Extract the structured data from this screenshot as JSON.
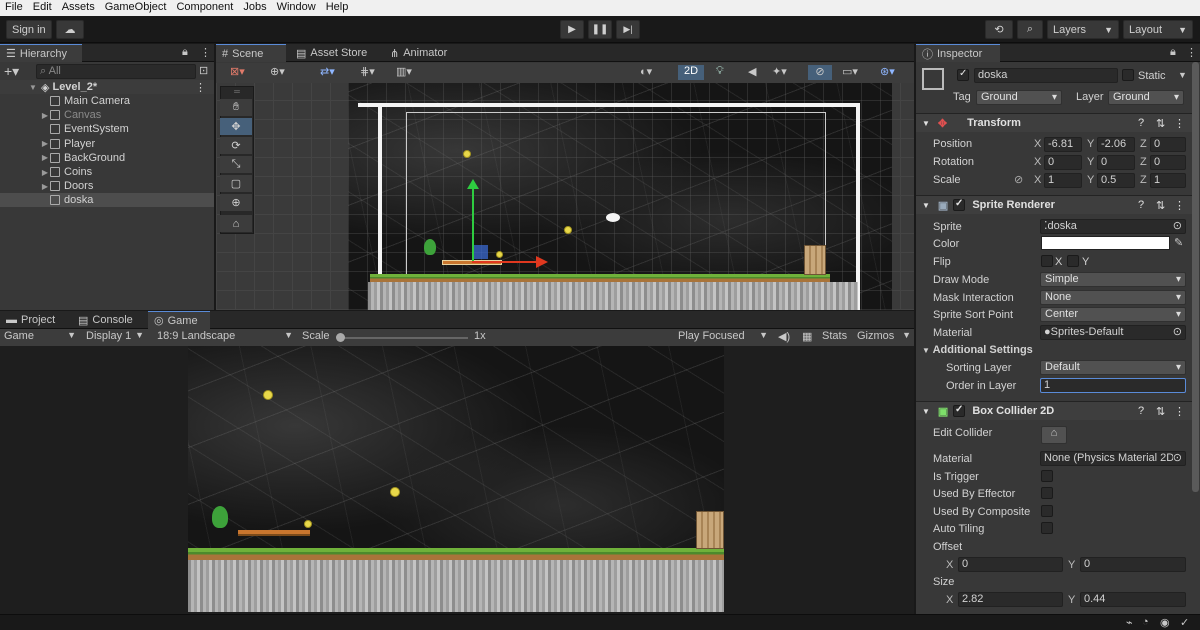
{
  "menu": [
    "File",
    "Edit",
    "Assets",
    "GameObject",
    "Component",
    "Jobs",
    "Window",
    "Help"
  ],
  "toolbar": {
    "sign_in": "Sign in",
    "layers": "Layers",
    "layout": "Layout"
  },
  "hierarchy": {
    "tab": "Hierarchy",
    "search_placeholder": "All",
    "scene": "Level_2*",
    "items": [
      {
        "label": "Main Camera",
        "expandable": false,
        "dim": false
      },
      {
        "label": "Canvas",
        "expandable": true,
        "dim": true
      },
      {
        "label": "EventSystem",
        "expandable": false,
        "dim": false
      },
      {
        "label": "Player",
        "expandable": true,
        "dim": false
      },
      {
        "label": "BackGround",
        "expandable": true,
        "dim": false
      },
      {
        "label": "Coins",
        "expandable": true,
        "dim": false
      },
      {
        "label": "Doors",
        "expandable": true,
        "dim": false
      },
      {
        "label": "doska",
        "expandable": false,
        "dim": false,
        "selected": true
      }
    ]
  },
  "scene_tabs": [
    "Scene",
    "Asset Store",
    "Animator"
  ],
  "scene_toolbar": {
    "mode_2d": "2D"
  },
  "bottom_tabs": [
    "Project",
    "Console",
    "Game"
  ],
  "game_toolbar": {
    "view": "Game",
    "display": "Display 1",
    "aspect": "18:9 Landscape",
    "scale_label": "Scale",
    "scale_value": "1x",
    "play_mode": "Play Focused",
    "stats": "Stats",
    "gizmos": "Gizmos"
  },
  "inspector": {
    "tab": "Inspector",
    "object_name": "doska",
    "static_label": "Static",
    "tag_label": "Tag",
    "tag_value": "Ground",
    "layer_label": "Layer",
    "layer_value": "Ground",
    "transform": {
      "title": "Transform",
      "position_label": "Position",
      "rotation_label": "Rotation",
      "scale_label": "Scale",
      "position": {
        "x": "-6.81",
        "y": "-2.06",
        "z": "0"
      },
      "rotation": {
        "x": "0",
        "y": "0",
        "z": "0"
      },
      "scale": {
        "x": "1",
        "y": "0.5",
        "z": "1"
      }
    },
    "sprite_renderer": {
      "title": "Sprite Renderer",
      "sprite_label": "Sprite",
      "sprite_value": "doska",
      "color_label": "Color",
      "flip_label": "Flip",
      "flip_x": "X",
      "flip_y": "Y",
      "draw_mode_label": "Draw Mode",
      "draw_mode_value": "Simple",
      "mask_label": "Mask Interaction",
      "mask_value": "None",
      "sort_point_label": "Sprite Sort Point",
      "sort_point_value": "Center",
      "material_label": "Material",
      "material_value": "Sprites-Default",
      "additional": "Additional Settings",
      "sorting_layer_label": "Sorting Layer",
      "sorting_layer_value": "Default",
      "order_label": "Order in Layer",
      "order_value": "1"
    },
    "box_collider": {
      "title": "Box Collider 2D",
      "edit_collider_label": "Edit Collider",
      "material_label": "Material",
      "material_value": "None (Physics Material 2D)",
      "is_trigger_label": "Is Trigger",
      "effector_label": "Used By Effector",
      "composite_label": "Used By Composite",
      "auto_tiling_label": "Auto Tiling",
      "offset_label": "Offset",
      "offset": {
        "x": "0",
        "y": "0"
      },
      "size_label": "Size",
      "size": {
        "x": "2.82",
        "y": "0.44"
      }
    }
  },
  "colors": {
    "accent": "#5a8bd8",
    "selection": "#2c5d87"
  }
}
